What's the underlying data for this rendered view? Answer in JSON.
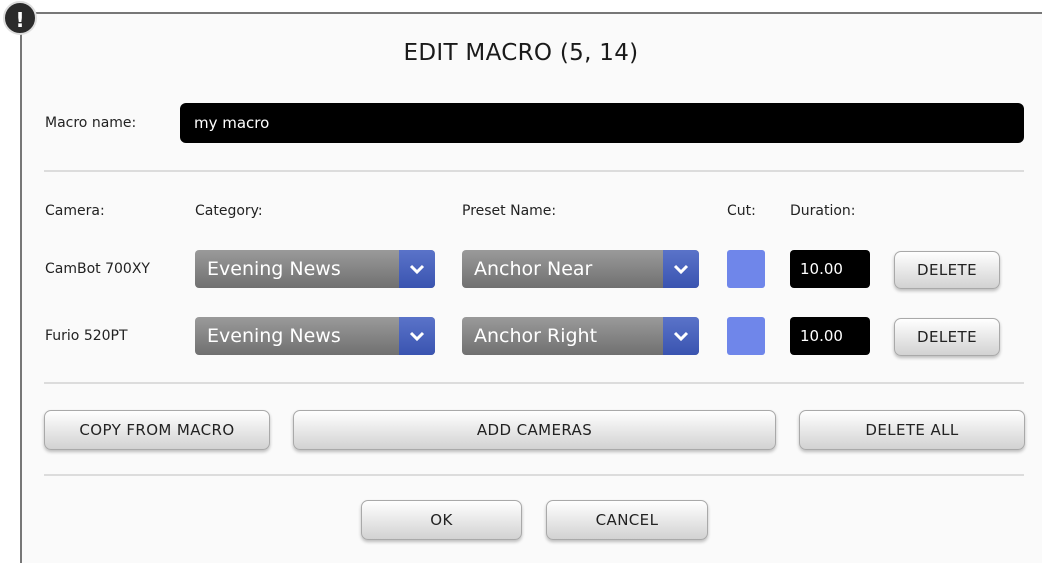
{
  "alert_glyph": "!",
  "title": "EDIT MACRO (5, 14)",
  "macro_name": {
    "label": "Macro name:",
    "value": "my macro"
  },
  "headers": {
    "camera": "Camera:",
    "category": "Category:",
    "preset": "Preset Name:",
    "cut": "Cut:",
    "duration": "Duration:"
  },
  "rows": [
    {
      "camera": "CamBot 700XY",
      "category": "Evening News",
      "preset": "Anchor Near",
      "duration": "10.00",
      "delete_label": "DELETE"
    },
    {
      "camera": "Furio 520PT",
      "category": "Evening News",
      "preset": "Anchor Right",
      "duration": "10.00",
      "delete_label": "DELETE"
    }
  ],
  "actions": {
    "copy_from_macro": "COPY FROM MACRO",
    "add_cameras": "ADD CAMERAS",
    "delete_all": "DELETE ALL"
  },
  "footer": {
    "ok": "OK",
    "cancel": "CANCEL"
  },
  "colors": {
    "cut_swatch": "#6f86ea",
    "dropdown_arrow": "#3a54b0",
    "input_bg": "#000000"
  },
  "icons": {
    "alert": "exclamation-circle-icon",
    "dropdown": "chevron-down-icon"
  }
}
